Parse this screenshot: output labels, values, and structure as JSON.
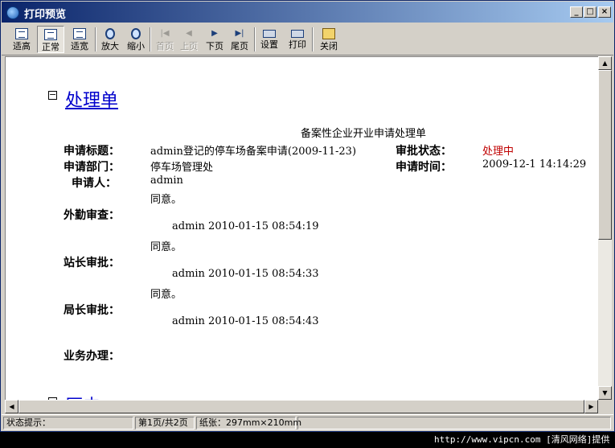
{
  "window": {
    "title": "打印预览"
  },
  "toolbar": {
    "buttons": [
      {
        "label": "适高",
        "icon": "page-fit-height-icon"
      },
      {
        "label": "正常",
        "icon": "page-normal-icon"
      },
      {
        "label": "适宽",
        "icon": "page-fit-width-icon"
      },
      {
        "label": "放大",
        "icon": "zoom-in-icon"
      },
      {
        "label": "缩小",
        "icon": "zoom-out-icon"
      },
      {
        "label": "首页",
        "icon": "first-page-icon"
      },
      {
        "label": "上页",
        "icon": "prev-page-icon"
      },
      {
        "label": "下页",
        "icon": "next-page-icon"
      },
      {
        "label": "尾页",
        "icon": "last-page-icon"
      },
      {
        "label": "设置",
        "icon": "page-setup-icon"
      },
      {
        "label": "打印",
        "icon": "printer-icon"
      },
      {
        "label": "关闭",
        "icon": "close-folder-icon"
      }
    ]
  },
  "document": {
    "section_title": "处理单",
    "next_section_title": "历史",
    "form_title": "备案性企业开业申请处理单",
    "fields": {
      "subject_label": "申请标题：",
      "subject_value": "admin登记的停车场备案申请(2009-11-23)",
      "status_label": "审批状态：",
      "status_value": "处理中",
      "dept_label": "申请部门：",
      "dept_value": "停车场管理处",
      "time_label": "申请时间：",
      "time_value": "2009-12-1 14:14:29",
      "applicant_label": "申请人：",
      "applicant_value": "admin"
    },
    "reviews": [
      {
        "label": "外勤审查：",
        "comment": "同意。",
        "signature": "admin 2010-01-15 08:54:19"
      },
      {
        "label": "站长审批：",
        "comment": "同意。",
        "signature": "admin 2010-01-15 08:54:33"
      },
      {
        "label": "局长审批：",
        "comment": "同意。",
        "signature": "admin 2010-01-15 08:54:43"
      }
    ],
    "final_label": "业务办理："
  },
  "statusbar": {
    "hint": "状态提示：",
    "page": "第1页/共2页",
    "paper": "纸张：297mm×210mm"
  },
  "watermark": "http://www.vipcn.com [清风网络]提供"
}
